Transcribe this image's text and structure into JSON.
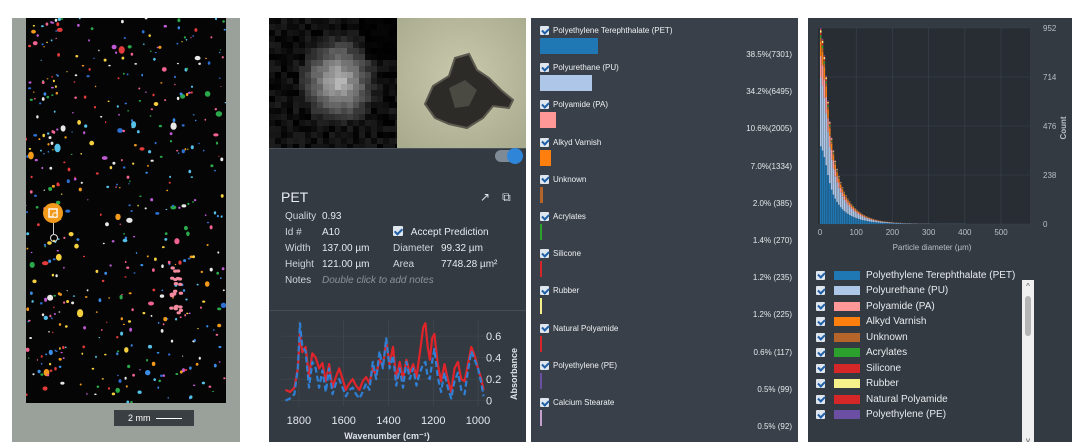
{
  "map": {
    "scale_label": "2 mm"
  },
  "detail": {
    "particle_name": "PET",
    "quality_label": "Quality",
    "quality_value": "0.93",
    "id_label": "Id #",
    "id_value": "A10",
    "accept_label": "Accept Prediction",
    "width_label": "Width",
    "width_value": "137.00 µm",
    "diameter_label": "Diameter",
    "diameter_value": "99.32 µm",
    "height_label": "Height",
    "height_value": "121.00 µm",
    "area_label": "Area",
    "area_value": "7748.28 µm²",
    "notes_label": "Notes",
    "notes_placeholder": "Double click to add notes",
    "spectrum": {
      "type": "line",
      "xlabel": "Wavenumber (cm⁻¹)",
      "ylabel": "Absorbance",
      "x_ticks": [
        1800,
        1600,
        1400,
        1200,
        1000
      ],
      "y_ticks": [
        0,
        0.2,
        0.4,
        0.6
      ],
      "xlim": [
        1880,
        960
      ],
      "ylim": [
        -0.05,
        0.75
      ],
      "series": [
        {
          "color": "#e0242b",
          "x": [
            1860,
            1840,
            1820,
            1805,
            1795,
            1785,
            1770,
            1755,
            1740,
            1725,
            1710,
            1695,
            1680,
            1665,
            1650,
            1635,
            1620,
            1605,
            1590,
            1575,
            1560,
            1545,
            1530,
            1515,
            1500,
            1485,
            1470,
            1455,
            1440,
            1425,
            1410,
            1395,
            1380,
            1365,
            1350,
            1335,
            1320,
            1305,
            1290,
            1275,
            1260,
            1245,
            1235,
            1225,
            1215,
            1205,
            1195,
            1180,
            1165,
            1150,
            1135,
            1120,
            1105,
            1090,
            1075,
            1060,
            1045,
            1030,
            1015,
            1000,
            985,
            975
          ],
          "y": [
            0.1,
            0.08,
            0.12,
            0.3,
            0.62,
            0.45,
            0.5,
            0.22,
            0.44,
            0.4,
            0.3,
            0.35,
            0.18,
            0.34,
            0.12,
            0.22,
            0.3,
            0.2,
            0.1,
            0.16,
            0.2,
            0.14,
            0.1,
            0.18,
            0.22,
            0.16,
            0.3,
            0.24,
            0.38,
            0.32,
            0.55,
            0.34,
            0.5,
            0.2,
            0.36,
            0.2,
            0.38,
            0.26,
            0.34,
            0.22,
            0.44,
            0.68,
            0.72,
            0.5,
            0.38,
            0.58,
            0.62,
            0.34,
            0.18,
            0.34,
            0.2,
            0.08,
            0.3,
            0.36,
            0.2,
            0.18,
            0.34,
            0.5,
            0.42,
            0.3,
            0.2,
            0.1
          ]
        },
        {
          "color": "#2f7fd4",
          "dashed": true,
          "x": [
            1860,
            1840,
            1820,
            1805,
            1795,
            1785,
            1770,
            1755,
            1740,
            1725,
            1710,
            1695,
            1680,
            1665,
            1650,
            1635,
            1620,
            1605,
            1590,
            1575,
            1560,
            1545,
            1530,
            1515,
            1500,
            1485,
            1470,
            1455,
            1440,
            1425,
            1410,
            1395,
            1380,
            1365,
            1350,
            1335,
            1320,
            1305,
            1290,
            1275,
            1260,
            1245,
            1235,
            1225,
            1215,
            1205,
            1195,
            1180,
            1165,
            1150,
            1135,
            1120,
            1105,
            1090,
            1075,
            1060,
            1045,
            1030,
            1015,
            1000,
            985,
            975
          ],
          "y": [
            0.0,
            0.02,
            0.06,
            0.3,
            0.72,
            0.5,
            0.46,
            0.12,
            0.36,
            0.3,
            0.12,
            0.28,
            0.08,
            0.3,
            0.06,
            0.16,
            0.2,
            0.12,
            0.04,
            0.1,
            0.12,
            0.06,
            0.02,
            0.08,
            0.16,
            0.1,
            0.36,
            0.2,
            0.46,
            0.3,
            0.58,
            0.3,
            0.42,
            0.14,
            0.3,
            0.12,
            0.36,
            0.2,
            0.3,
            0.14,
            0.26,
            0.34,
            0.36,
            0.22,
            0.2,
            0.36,
            0.48,
            0.22,
            0.08,
            0.26,
            0.12,
            0.02,
            0.18,
            0.26,
            0.1,
            0.06,
            0.28,
            0.46,
            0.38,
            0.3,
            0.16,
            0.04
          ]
        }
      ]
    }
  },
  "classes": [
    {
      "name": "Polyethylene Terephthalate (PET)",
      "pct": "38.5%(7301)",
      "fraction": 0.385,
      "color": "#1f77b4"
    },
    {
      "name": "Polyurethane (PU)",
      "pct": "34.2%(6495)",
      "fraction": 0.342,
      "color": "#aec7e8"
    },
    {
      "name": "Polyamide (PA)",
      "pct": "10.6%(2005)",
      "fraction": 0.106,
      "color": "#ff9896"
    },
    {
      "name": "Alkyd Varnish",
      "pct": "7.0%(1334)",
      "fraction": 0.07,
      "color": "#ff7f0e"
    },
    {
      "name": "Unknown",
      "pct": "2.0% (385)",
      "fraction": 0.02,
      "color": "#b5652a"
    },
    {
      "name": "Acrylates",
      "pct": "1.4% (270)",
      "fraction": 0.014,
      "color": "#2ca02c"
    },
    {
      "name": "Silicone",
      "pct": "1.2% (235)",
      "fraction": 0.012,
      "color": "#d62728"
    },
    {
      "name": "Rubber",
      "pct": "1.2% (225)",
      "fraction": 0.012,
      "color": "#f6f08a"
    },
    {
      "name": "Natural Polyamide",
      "pct": "0.6% (117)",
      "fraction": 0.006,
      "color": "#d62728"
    },
    {
      "name": "Polyethylene (PE)",
      "pct": "0.5% (99)",
      "fraction": 0.005,
      "color": "#6a4fa3"
    },
    {
      "name": "Calcium Stearate",
      "pct": "0.5% (92)",
      "fraction": 0.005,
      "color": "#c4a0cf"
    }
  ],
  "histogram": {
    "type": "bar",
    "xlabel": "Particle diameter (µm)",
    "ylabel": "Count",
    "x_ticks": [
      0,
      100,
      200,
      300,
      400,
      500
    ],
    "y_ticks": [
      0,
      238,
      476,
      714,
      952
    ],
    "xlim": [
      0,
      580
    ],
    "ylim": [
      0,
      952
    ],
    "bin_width": 5,
    "totals": [
      952,
      900,
      820,
      720,
      600,
      500,
      420,
      360,
      310,
      270,
      235,
      205,
      180,
      158,
      140,
      124,
      110,
      98,
      88,
      78,
      70,
      62,
      55,
      49,
      44,
      39,
      35,
      31,
      28,
      25,
      22,
      20,
      18,
      16,
      14,
      13,
      12,
      11,
      10,
      9,
      8,
      7,
      7,
      6,
      6,
      5,
      5,
      4,
      4,
      4,
      3,
      3,
      3,
      3,
      2,
      2,
      2,
      2,
      2,
      2,
      2,
      1,
      1,
      1,
      1,
      1,
      1,
      1,
      1,
      1,
      1,
      1,
      1,
      1,
      1,
      1,
      1,
      1,
      1,
      1
    ],
    "legend": [
      {
        "name": "Polyethylene Terephthalate (PET)",
        "color": "#1f77b4"
      },
      {
        "name": "Polyurethane (PU)",
        "color": "#aec7e8"
      },
      {
        "name": "Polyamide (PA)",
        "color": "#ff9896"
      },
      {
        "name": "Alkyd Varnish",
        "color": "#ff7f0e"
      },
      {
        "name": "Unknown",
        "color": "#b5652a"
      },
      {
        "name": "Acrylates",
        "color": "#2ca02c"
      },
      {
        "name": "Silicone",
        "color": "#d62728"
      },
      {
        "name": "Rubber",
        "color": "#f6f08a"
      },
      {
        "name": "Natural Polyamide",
        "color": "#d62728"
      },
      {
        "name": "Polyethylene (PE)",
        "color": "#6a4fa3"
      }
    ]
  }
}
